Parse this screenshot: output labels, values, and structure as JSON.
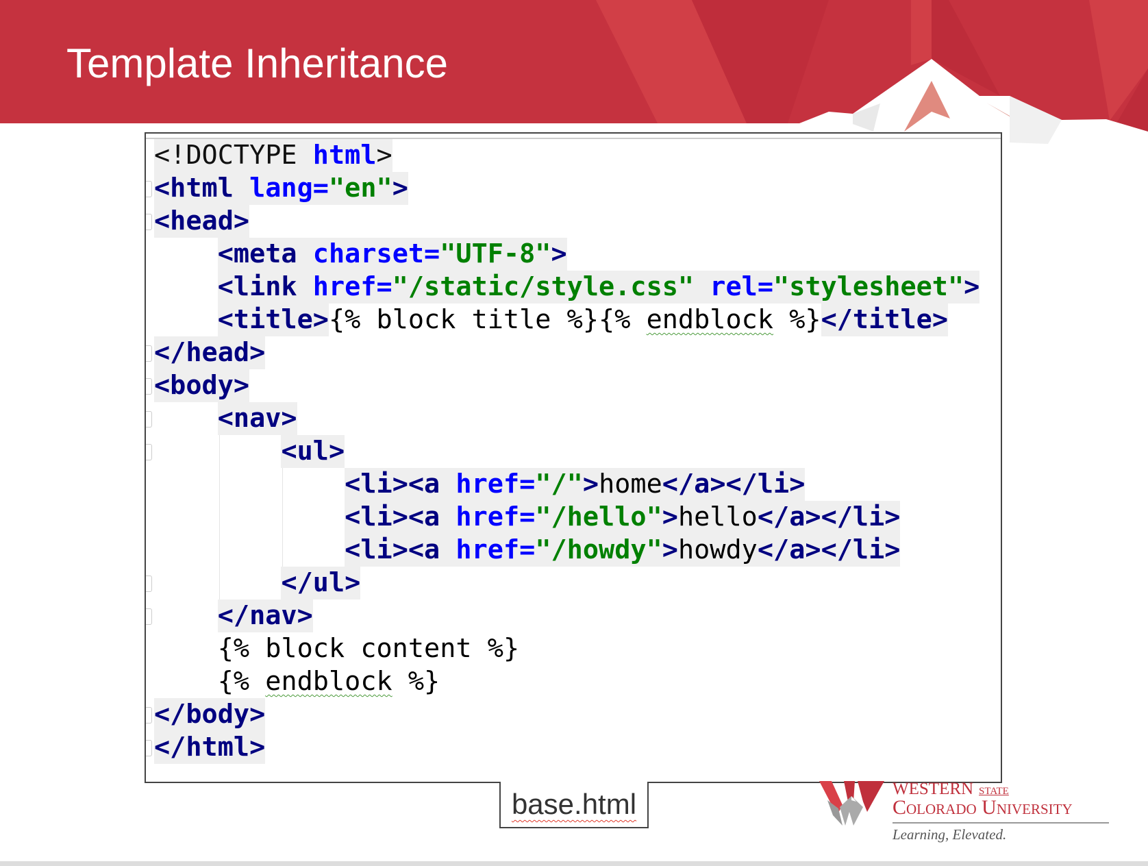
{
  "slide": {
    "title": "Template Inheritance",
    "file_label": "base.html"
  },
  "colors": {
    "header_red": "#c5323f",
    "tag": "#000080",
    "attr": "#0000ff",
    "value": "#008000"
  },
  "code": {
    "lines": [
      {
        "indent": 0,
        "tokens": [
          [
            "plain",
            "<!DOCTYPE "
          ],
          [
            "attr",
            "html"
          ],
          [
            "plain",
            ">"
          ]
        ]
      },
      {
        "indent": 0,
        "tokens": [
          [
            "tag",
            "<html "
          ],
          [
            "attr",
            "lang="
          ],
          [
            "val",
            "\"en\""
          ],
          [
            "tag",
            ">"
          ]
        ]
      },
      {
        "indent": 0,
        "tokens": [
          [
            "tag",
            "<head>"
          ]
        ]
      },
      {
        "indent": 1,
        "tokens": [
          [
            "tag",
            "<meta "
          ],
          [
            "attr",
            "charset="
          ],
          [
            "val",
            "\"UTF-8\""
          ],
          [
            "tag",
            ">"
          ]
        ]
      },
      {
        "indent": 1,
        "tokens": [
          [
            "tag",
            "<link "
          ],
          [
            "attr",
            "href="
          ],
          [
            "val",
            "\"/static/style.css\" "
          ],
          [
            "attr",
            "rel="
          ],
          [
            "val",
            "\"stylesheet\""
          ],
          [
            "tag",
            ">"
          ]
        ]
      },
      {
        "indent": 1,
        "tokens": [
          [
            "tag",
            "<title>"
          ],
          [
            "text",
            "{% block title %}{% "
          ],
          [
            "squig",
            "endblock"
          ],
          [
            "text",
            " %}"
          ],
          [
            "tag",
            "</title>"
          ]
        ]
      },
      {
        "indent": 0,
        "tokens": [
          [
            "tag",
            "</head>"
          ]
        ]
      },
      {
        "indent": 0,
        "tokens": [
          [
            "tag",
            "<body>"
          ]
        ]
      },
      {
        "indent": 1,
        "tokens": [
          [
            "tag",
            "<nav>"
          ]
        ]
      },
      {
        "indent": 2,
        "tokens": [
          [
            "tag",
            "<ul>"
          ]
        ]
      },
      {
        "indent": 3,
        "tokens": [
          [
            "tag",
            "<li><a "
          ],
          [
            "attr",
            "href="
          ],
          [
            "val",
            "\"/\""
          ],
          [
            "tag",
            ">"
          ],
          [
            "text",
            "home"
          ],
          [
            "tag",
            "</a></li>"
          ]
        ]
      },
      {
        "indent": 3,
        "tokens": [
          [
            "tag",
            "<li><a "
          ],
          [
            "attr",
            "href="
          ],
          [
            "val",
            "\"/hello\""
          ],
          [
            "tag",
            ">"
          ],
          [
            "text",
            "hello"
          ],
          [
            "tag",
            "</a></li>"
          ]
        ]
      },
      {
        "indent": 3,
        "tokens": [
          [
            "tag",
            "<li><a "
          ],
          [
            "attr",
            "href="
          ],
          [
            "val",
            "\"/howdy\""
          ],
          [
            "tag",
            ">"
          ],
          [
            "text",
            "howdy"
          ],
          [
            "tag",
            "</a></li>"
          ]
        ]
      },
      {
        "indent": 2,
        "tokens": [
          [
            "tag",
            "</ul>"
          ]
        ]
      },
      {
        "indent": 1,
        "tokens": [
          [
            "tag",
            "</nav>"
          ]
        ]
      },
      {
        "indent": 1,
        "tokens": [
          [
            "text",
            "{% block content %}"
          ]
        ]
      },
      {
        "indent": 1,
        "tokens": [
          [
            "text",
            "{% "
          ],
          [
            "squig",
            "endblock"
          ],
          [
            "text",
            " %}"
          ]
        ]
      },
      {
        "indent": 0,
        "tokens": [
          [
            "tag",
            "</body>"
          ]
        ]
      },
      {
        "indent": 0,
        "tokens": [
          [
            "tag",
            "</html>"
          ]
        ]
      }
    ]
  },
  "logo": {
    "line1": "Western",
    "line1b": "STATE",
    "line2": "Colorado University",
    "tagline": "Learning, Elevated."
  }
}
